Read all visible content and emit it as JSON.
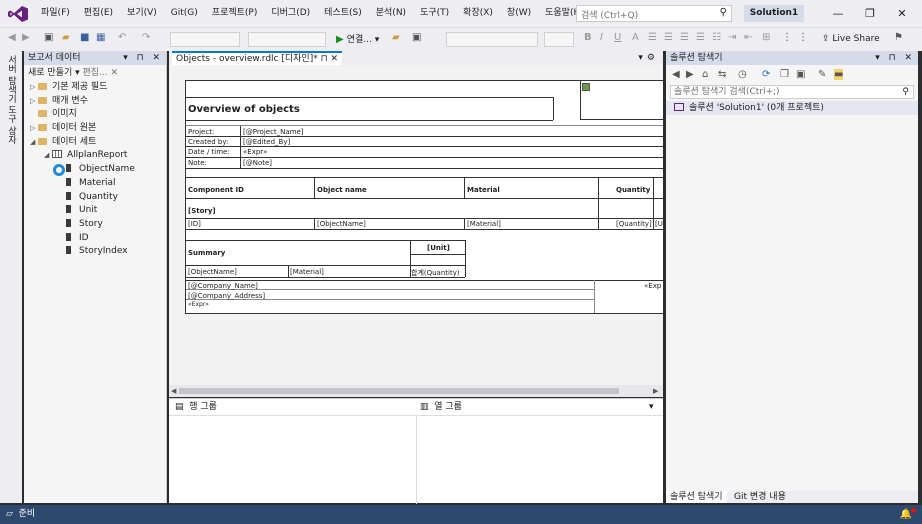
{
  "menu": {
    "items": [
      "파일(F)",
      "편집(E)",
      "보기(V)",
      "Git(G)",
      "프로젝트(P)",
      "디버그(D)",
      "테스트(S)",
      "분석(N)",
      "도구(T)",
      "확장(X)",
      "창(W)",
      "도움말(H)"
    ],
    "search_placeholder": "검색 (Ctrl+Q)",
    "solution_name": "Solution1"
  },
  "toolbar": {
    "run_label": "연결...",
    "live_share": "Live Share"
  },
  "left_strip": {
    "tabs": [
      "서버 탐색기",
      "도구 상자"
    ]
  },
  "report_data": {
    "title": "보고서 데이터",
    "new_label": "새로 만들기",
    "edit_label": "편집...",
    "items": [
      {
        "label": "기본 제공 필드",
        "type": "folder",
        "level": 0,
        "toggle": "▷"
      },
      {
        "label": "매개 변수",
        "type": "folder",
        "level": 0,
        "toggle": "▷"
      },
      {
        "label": "이미지",
        "type": "folder",
        "level": 0,
        "toggle": ""
      },
      {
        "label": "데이터 원본",
        "type": "folder",
        "level": 0,
        "toggle": "▷"
      },
      {
        "label": "데이터 세트",
        "type": "folder",
        "level": 0,
        "toggle": "◢"
      },
      {
        "label": "AllplanReport",
        "type": "table",
        "level": 1,
        "toggle": "◢"
      },
      {
        "label": "ObjectName",
        "type": "field",
        "level": 2,
        "toggle": ""
      },
      {
        "label": "Material",
        "type": "field",
        "level": 2,
        "toggle": ""
      },
      {
        "label": "Quantity",
        "type": "field",
        "level": 2,
        "toggle": ""
      },
      {
        "label": "Unit",
        "type": "field",
        "level": 2,
        "toggle": ""
      },
      {
        "label": "Story",
        "type": "field",
        "level": 2,
        "toggle": ""
      },
      {
        "label": "ID",
        "type": "field",
        "level": 2,
        "toggle": ""
      },
      {
        "label": "StoryIndex",
        "type": "field",
        "level": 2,
        "toggle": ""
      }
    ]
  },
  "document": {
    "tab_label": "Objects - overview.rdlc [디자인]*"
  },
  "report": {
    "title": "Overview of objects",
    "project_label": "Project:",
    "project_value": "[@Project_Name]",
    "created_label": "Created by:",
    "created_value": "[@Edited_By]",
    "date_label": "Date / time:",
    "date_value": "«Expr»",
    "note_label": "Note:",
    "note_value": "[@Note]",
    "col_component": "Component ID",
    "col_object": "Object name",
    "col_material": "Material",
    "col_quantity": "Quantity",
    "story_group": "[Story]",
    "row_id": "[ID]",
    "row_object": "[ObjectName]",
    "row_material": "[Material]",
    "row_quantity": "[Quantity]",
    "row_unit": "[U",
    "summary_label": "Summary",
    "summary_unit": "[Unit]",
    "summary_object": "[ObjectName]",
    "summary_material": "[Material]",
    "summary_sum": "합계(Quantity)",
    "company_name": "[@Company_Name]",
    "company_address": "[@Company_Address]",
    "footer_expr": "«Expr»",
    "footer_expr_right": "«Exp"
  },
  "grouping": {
    "row_groups": "행 그룹",
    "col_groups": "열 그룹"
  },
  "solution_explorer": {
    "title": "솔루션 탐색기",
    "search_placeholder": "솔루션 탐색기 검색(Ctrl+;)",
    "solution_row": "솔루션 'Solution1' (0개 프로젝트)",
    "bottom_tabs": [
      "솔루션 탐색기",
      "Git 변경 내용"
    ]
  },
  "status": {
    "text": "준비"
  }
}
